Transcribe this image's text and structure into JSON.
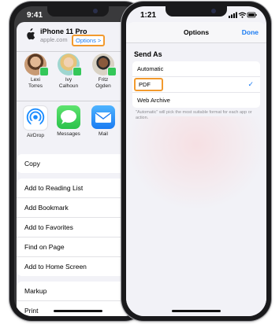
{
  "phone1": {
    "status_time": "9:41",
    "share_header": {
      "page_title": "iPhone 11 Pro",
      "page_domain": "apple.com",
      "options_label": "Options >"
    },
    "people": [
      {
        "name": "Lexi\nTorres",
        "avatar_color": "#c89a74"
      },
      {
        "name": "Ivy\nCalhoun",
        "avatar_color": "#9fd6d0"
      },
      {
        "name": "Fritz\nOgden",
        "avatar_color": "#6b5a4a"
      }
    ],
    "apps": [
      {
        "label": "AirDrop",
        "icon": "airdrop-icon",
        "color": "#1a8cff"
      },
      {
        "label": "Messages",
        "icon": "messages-icon",
        "color": "#34c759"
      },
      {
        "label": "Mail",
        "icon": "mail-icon",
        "color": "#3b9cff"
      }
    ],
    "action_groups": [
      [
        "Copy"
      ],
      [
        "Add to Reading List",
        "Add Bookmark",
        "Add to Favorites",
        "Find on Page",
        "Add to Home Screen"
      ],
      [
        "Markup",
        "Print"
      ]
    ]
  },
  "phone2": {
    "status_time": "1:21",
    "nav_title": "Options",
    "done_label": "Done",
    "section_title": "Send As",
    "options": [
      {
        "label": "Automatic",
        "selected": false
      },
      {
        "label": "PDF",
        "selected": true
      },
      {
        "label": "Web Archive",
        "selected": false
      }
    ],
    "check_mark": "✓",
    "footnote": "\"Automatic\" will pick the most suitable format for each app or action."
  },
  "colors": {
    "accent": "#1a7bf2",
    "highlight": "#f29a2e",
    "badge_green": "#34c759"
  }
}
